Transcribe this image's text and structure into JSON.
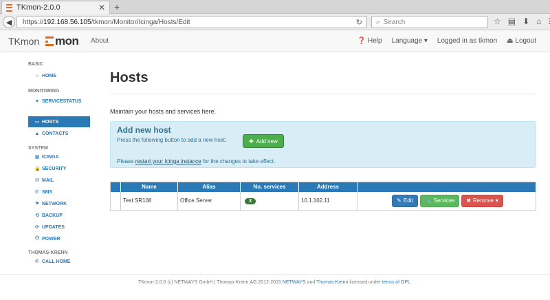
{
  "browser": {
    "tab_title": "TKmon-2.0.0",
    "tab_close": "✕",
    "new_tab": "+",
    "back": "◀",
    "url_prefix": "https://",
    "url_host": "192.168.56.105",
    "url_path": "/tkmon/Monitor/Icinga/Hosts/Edit",
    "reload": "↻",
    "search_placeholder": "Search",
    "toolbar_icons": [
      "☆",
      "▤",
      "⬇",
      "⌂",
      "☰"
    ]
  },
  "appbar": {
    "brand": "TKmon",
    "logo_text": "mon",
    "about": "About",
    "help": "Help",
    "language": "Language",
    "logged_in": "Logged in as tkmon",
    "logout": "Logout"
  },
  "sidebar": {
    "sections": [
      {
        "title": "BASIC",
        "items": [
          {
            "icon": "⌂",
            "label": "HOME"
          }
        ]
      },
      {
        "title": "MONITORING",
        "items": [
          {
            "icon": "♥",
            "label": "SERVICESTATUS"
          }
        ]
      },
      {
        "title": "",
        "items": [
          {
            "icon": "▭",
            "label": "HOSTS",
            "active": true
          },
          {
            "icon": "▲",
            "label": "CONTACTS"
          }
        ]
      },
      {
        "title": "SYSTEM",
        "items": [
          {
            "icon": "▦",
            "label": "ICINGA"
          },
          {
            "icon": "🔒",
            "label": "SECURITY"
          },
          {
            "icon": "✉",
            "label": "MAIL"
          },
          {
            "icon": "✆",
            "label": "SMS"
          },
          {
            "icon": "⚑",
            "label": "NETWORK"
          },
          {
            "icon": "⟲",
            "label": "BACKUP"
          },
          {
            "icon": "⟳",
            "label": "UPDATES"
          },
          {
            "icon": "⏻",
            "label": "POWER"
          }
        ]
      },
      {
        "title": "THOMAS-KRENN",
        "items": [
          {
            "icon": "✆",
            "label": "CALL HOME"
          }
        ]
      }
    ]
  },
  "main": {
    "title": "Hosts",
    "intro": "Maintain your hosts and services here.",
    "panel": {
      "heading": "Add new host",
      "text": "Press the following button to add a new host:",
      "add_label": "Add new",
      "note_prefix": "Please ",
      "note_link": "restart your Icinga instance",
      "note_suffix": " for the changes to take effect."
    },
    "table": {
      "headers": [
        "",
        "Name",
        "Alias",
        "No. services",
        "Address",
        ""
      ],
      "rows": [
        {
          "name": "Test SR108",
          "alias": "Office Server",
          "services": "3",
          "address": "10.1.102.11"
        }
      ],
      "actions": {
        "edit": "Edit",
        "services": "Services",
        "remove": "Remove"
      }
    }
  },
  "footer": {
    "text1": "TKmon-2.0.0 (c) NETWAYS GmbH | Thomas-Krenn.AG 2012-2015 ",
    "link1": "NETWAYS",
    "text2": " and ",
    "link2": "Thomas-Krenn",
    "text3": " licensed under ",
    "link3": "terms of GPL",
    "text4": "."
  }
}
